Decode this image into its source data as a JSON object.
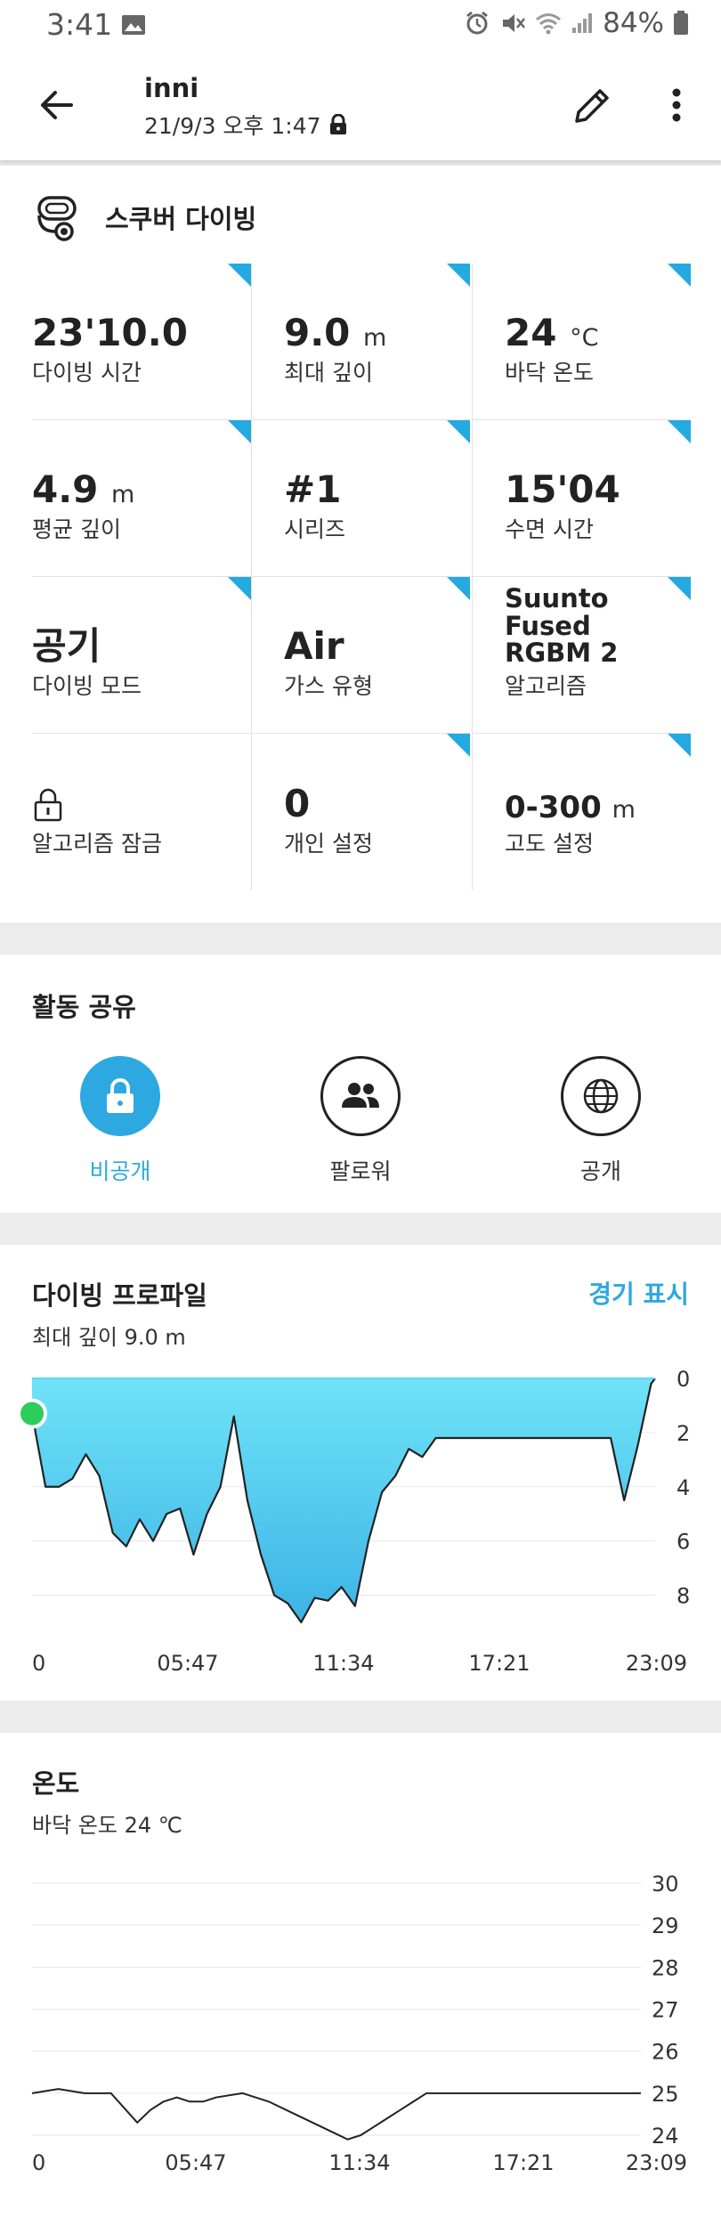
{
  "status_bar": {
    "time": "3:41",
    "battery": "84%"
  },
  "header": {
    "name": "inni",
    "datetime": "21/9/3 오후 1:47"
  },
  "activity": {
    "type": "스쿠버 다이빙",
    "stats": [
      {
        "value": "23'10.0",
        "unit": "",
        "label": "다이빙 시간"
      },
      {
        "value": "9.0",
        "unit": "m",
        "label": "최대 깊이"
      },
      {
        "value": "24",
        "unit": "°C",
        "label": "바닥 온도"
      },
      {
        "value": "4.9",
        "unit": "m",
        "label": "평균 깊이"
      },
      {
        "value": "#1",
        "unit": "",
        "label": "시리즈"
      },
      {
        "value": "15'04",
        "unit": "",
        "label": "수면 시간"
      },
      {
        "value": "공기",
        "unit": "",
        "label": "다이빙 모드"
      },
      {
        "value": "Air",
        "unit": "",
        "label": "가스 유형"
      },
      {
        "value": "Suunto Fused RGBM 2",
        "unit": "",
        "label": "알고리즘"
      },
      {
        "value": "",
        "unit": "",
        "label": "알고리즘 잠금",
        "icon": "lock-icon"
      },
      {
        "value": "0",
        "unit": "",
        "label": "개인 설정"
      },
      {
        "value": "0-300",
        "unit": "m",
        "label": "고도 설정"
      }
    ]
  },
  "share": {
    "title": "활동 공유",
    "options": [
      {
        "label": "비공개",
        "icon": "lock-icon",
        "selected": true
      },
      {
        "label": "팔로워",
        "icon": "people-icon",
        "selected": false
      },
      {
        "label": "공개",
        "icon": "globe-icon",
        "selected": false
      }
    ]
  },
  "profile": {
    "title": "다이빙 프로파일",
    "subtitle": "최대 깊이 9.0 m",
    "warnings_link": "경기 표시"
  },
  "temperature": {
    "title": "온도",
    "subtitle": "바닥 온도 24 ℃"
  },
  "colors": {
    "accent": "#2ea8e0",
    "corner": "#24a9e1",
    "depth_fill_top": "#6fe3f7",
    "depth_fill_bottom": "#3cb3e6",
    "start_marker": "#2ecc5a"
  },
  "chart_data": [
    {
      "type": "area",
      "title": "다이빙 프로파일",
      "xlabel": "",
      "ylabel": "",
      "x_ticks": [
        "0",
        "05:47",
        "11:34",
        "17:21",
        "23:09"
      ],
      "y_ticks": [
        "0",
        "2",
        "4",
        "6",
        "8"
      ],
      "ylim": [
        0,
        9
      ],
      "y_inverted": true,
      "xlim_seconds": [
        0,
        1389
      ],
      "series": [
        {
          "x": [
            0,
            30,
            60,
            90,
            120,
            150,
            180,
            210,
            240,
            270,
            300,
            330,
            360,
            390,
            420,
            450,
            480,
            510,
            540,
            570,
            600,
            630,
            660,
            690,
            720,
            750,
            780,
            810,
            840,
            870,
            900,
            930,
            960,
            990,
            1020,
            1050,
            1080,
            1110,
            1140,
            1170,
            1200,
            1230,
            1260,
            1290,
            1320,
            1350,
            1380,
            1389
          ],
          "values": [
            1.3,
            4.0,
            4.0,
            3.7,
            2.8,
            3.6,
            5.7,
            6.2,
            5.2,
            6.0,
            5.0,
            4.8,
            6.5,
            5.0,
            4.0,
            1.4,
            4.5,
            6.5,
            8.0,
            8.3,
            9.0,
            8.1,
            8.2,
            7.7,
            8.4,
            6.0,
            4.2,
            3.6,
            2.6,
            2.9,
            2.2,
            2.2,
            2.2,
            2.2,
            2.2,
            2.2,
            2.2,
            2.2,
            2.2,
            2.2,
            2.2,
            2.2,
            2.2,
            2.2,
            4.5,
            2.5,
            0.2,
            0.0
          ]
        }
      ]
    },
    {
      "type": "line",
      "title": "온도",
      "xlabel": "",
      "ylabel": "",
      "x_ticks": [
        "0",
        "05:47",
        "11:34",
        "17:21",
        "23:09"
      ],
      "y_ticks": [
        "30",
        "29",
        "28",
        "27",
        "26",
        "25",
        "24"
      ],
      "ylim": [
        23.7,
        30
      ],
      "xlim_seconds": [
        0,
        1389
      ],
      "series": [
        {
          "x": [
            0,
            60,
            120,
            180,
            240,
            270,
            300,
            330,
            360,
            390,
            420,
            480,
            540,
            600,
            660,
            720,
            750,
            780,
            810,
            840,
            870,
            900,
            960,
            1020,
            1080,
            1140,
            1200,
            1260,
            1320,
            1389
          ],
          "values": [
            25.0,
            25.1,
            25.0,
            25.0,
            24.3,
            24.6,
            24.8,
            24.9,
            24.8,
            24.8,
            24.9,
            25.0,
            24.8,
            24.5,
            24.2,
            23.9,
            24.0,
            24.2,
            24.4,
            24.6,
            24.8,
            25.0,
            25.0,
            25.0,
            25.0,
            25.0,
            25.0,
            25.0,
            25.0,
            25.0
          ]
        }
      ]
    }
  ]
}
